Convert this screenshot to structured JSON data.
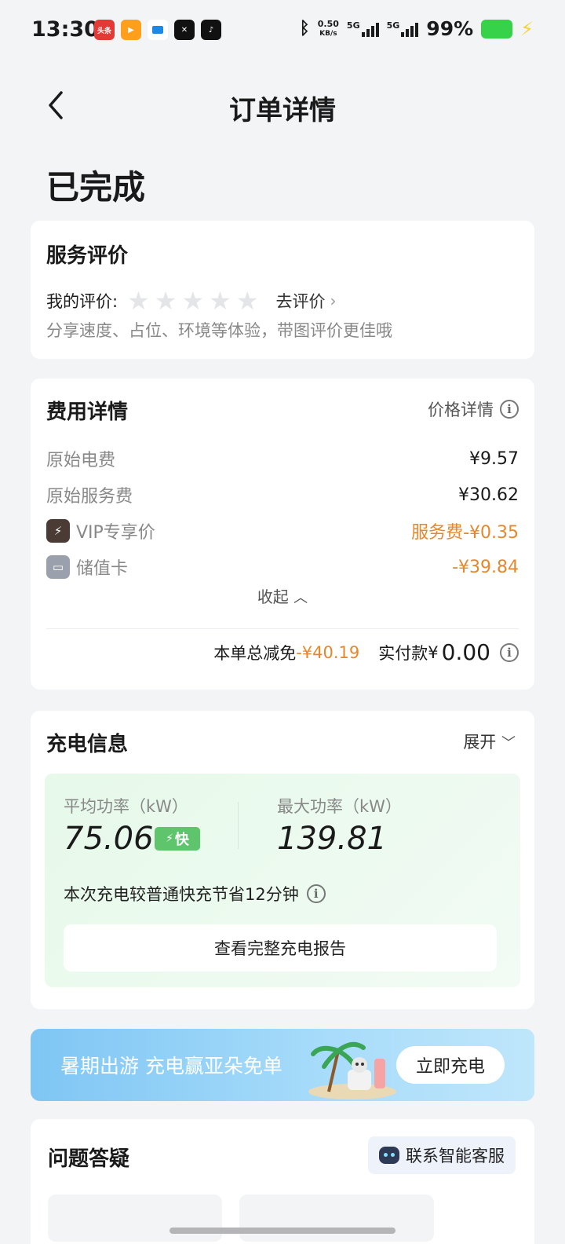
{
  "status_bar": {
    "time": "13:30",
    "app_icons": [
      "头条",
      "",
      "",
      "✕",
      "♪"
    ],
    "net_speed_value": "0.50",
    "net_speed_unit": "KB/s",
    "sim1": "5G",
    "sim2": "5G",
    "battery": "99%"
  },
  "header": {
    "title": "订单详情"
  },
  "order_status": "已完成",
  "rating": {
    "title": "服务评价",
    "my_rating_label": "我的评价:",
    "stars": 5,
    "go_rate": "去评价",
    "hint": "分享速度、占位、环境等体验，带图评价更佳哦"
  },
  "fees": {
    "title": "费用详情",
    "price_detail": "价格详情",
    "rows": [
      {
        "label": "原始电费",
        "value": "¥9.57"
      },
      {
        "label": "原始服务费",
        "value": "¥30.62"
      },
      {
        "label": "VIP专享价",
        "value": "服务费-¥0.35"
      },
      {
        "label": "储值卡",
        "value": "-¥39.84"
      }
    ],
    "collapse": "收起",
    "total_discount_label": "本单总减免",
    "total_discount_value": "-¥40.19",
    "paid_label": "实付款",
    "paid_currency": "¥",
    "paid_value": "0.00"
  },
  "charging": {
    "title": "充电信息",
    "expand": "展开",
    "avg_power_label": "平均功率（kW）",
    "avg_power_value": "75.06",
    "fast_badge": "快",
    "max_power_label": "最大功率（kW）",
    "max_power_value": "139.81",
    "saving_text": "本次充电较普通快充节省12分钟",
    "report_button": "查看完整充电报告"
  },
  "promo": {
    "text": "暑期出游 充电赢亚朵免单",
    "button": "立即充电"
  },
  "faq": {
    "title": "问题答疑",
    "customer_service": "联系智能客服"
  },
  "colors": {
    "orange": "#e8872a",
    "green_badge": "#5fc56d",
    "background": "#f3f4f6"
  }
}
